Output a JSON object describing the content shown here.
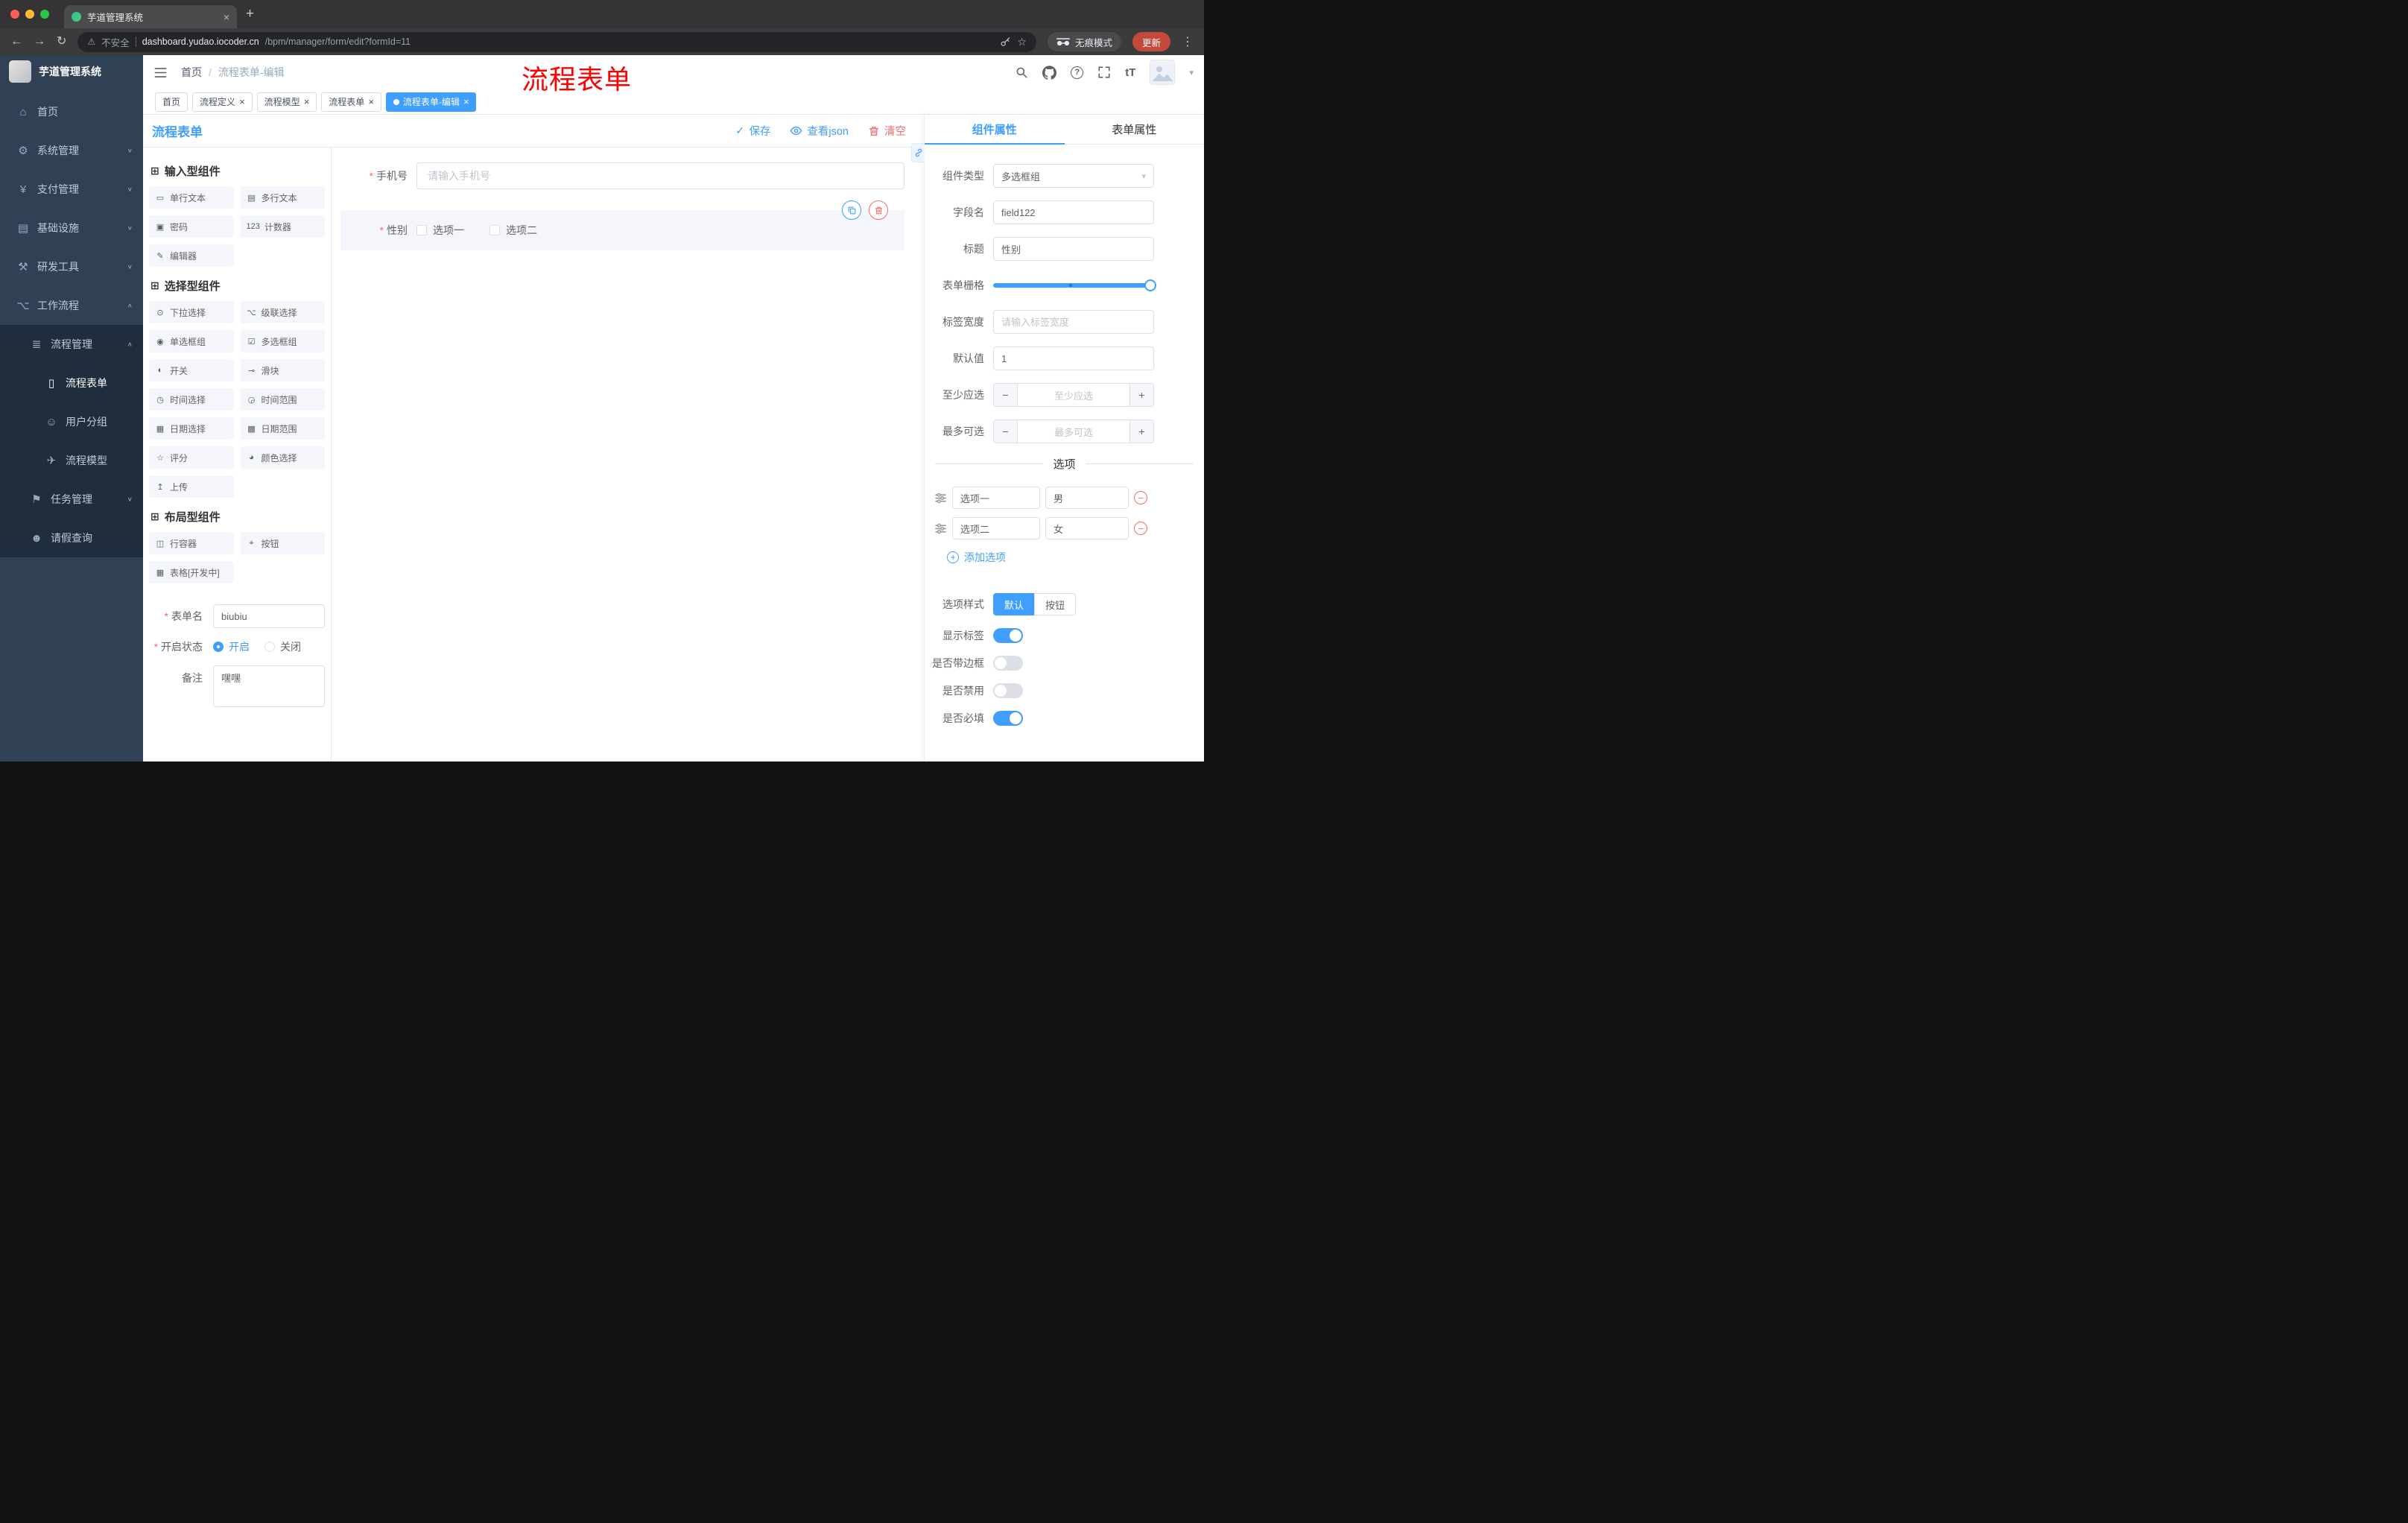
{
  "browser": {
    "tab_title": "芋道管理系统",
    "security_label": "不安全",
    "url_host": "dashboard.yudao.iocoder.cn",
    "url_path": "/bpm/manager/form/edit?formId=11",
    "incognito_label": "无痕模式",
    "update_label": "更新"
  },
  "sidebar": {
    "logo_title": "芋道管理系统",
    "items": [
      {
        "icon": "home",
        "label": "首页",
        "level": 0
      },
      {
        "icon": "gear",
        "label": "系统管理",
        "level": 0,
        "chevron": "down"
      },
      {
        "icon": "yen",
        "label": "支付管理",
        "level": 0,
        "chevron": "down"
      },
      {
        "icon": "monitor",
        "label": "基础设施",
        "level": 0,
        "chevron": "down"
      },
      {
        "icon": "tools",
        "label": "研发工具",
        "level": 0,
        "chevron": "down"
      },
      {
        "icon": "workflow",
        "label": "工作流程",
        "level": 0,
        "chevron": "up"
      },
      {
        "icon": "list",
        "label": "流程管理",
        "level": 1,
        "chevron": "up"
      },
      {
        "icon": "form",
        "label": "流程表单",
        "level": 2,
        "active": true
      },
      {
        "icon": "users",
        "label": "用户分组",
        "level": 2
      },
      {
        "icon": "model",
        "label": "流程模型",
        "level": 2
      },
      {
        "icon": "tasks",
        "label": "任务管理",
        "level": 1,
        "chevron": "down"
      },
      {
        "icon": "person",
        "label": "请假查询",
        "level": 1
      }
    ]
  },
  "navbar": {
    "breadcrumb": [
      "首页",
      "流程表单-编辑"
    ],
    "separator": "/"
  },
  "annotation": "流程表单",
  "tagbar": {
    "tags": [
      {
        "label": "首页",
        "closable": false,
        "active": false
      },
      {
        "label": "流程定义",
        "closable": true,
        "active": false
      },
      {
        "label": "流程模型",
        "closable": true,
        "active": false
      },
      {
        "label": "流程表单",
        "closable": true,
        "active": false
      },
      {
        "label": "流程表单-编辑",
        "closable": true,
        "active": true
      }
    ]
  },
  "designer": {
    "title": "流程表单",
    "toolbar": {
      "save": "保存",
      "view_json": "查看json",
      "clear": "清空"
    },
    "palette": {
      "groups": [
        {
          "title": "输入型组件",
          "items": [
            {
              "icon": "single-line",
              "label": "单行文本"
            },
            {
              "icon": "multi-line",
              "label": "多行文本"
            },
            {
              "icon": "password",
              "label": "密码"
            },
            {
              "icon": "counter",
              "label": "计数器"
            },
            {
              "icon": "editor",
              "label": "编辑器"
            }
          ]
        },
        {
          "title": "选择型组件",
          "items": [
            {
              "icon": "select",
              "label": "下拉选择"
            },
            {
              "icon": "cascader",
              "label": "级联选择"
            },
            {
              "icon": "radio-group",
              "label": "单选框组"
            },
            {
              "icon": "checkbox-group",
              "label": "多选框组"
            },
            {
              "icon": "switch",
              "label": "开关"
            },
            {
              "icon": "slider",
              "label": "滑块"
            },
            {
              "icon": "time",
              "label": "时间选择"
            },
            {
              "icon": "time-range",
              "label": "时间范围"
            },
            {
              "icon": "date",
              "label": "日期选择"
            },
            {
              "icon": "date-range",
              "label": "日期范围"
            },
            {
              "icon": "rate",
              "label": "评分"
            },
            {
              "icon": "color",
              "label": "颜色选择"
            },
            {
              "icon": "upload",
              "label": "上传"
            }
          ]
        },
        {
          "title": "布局型组件",
          "items": [
            {
              "icon": "row",
              "label": "行容器"
            },
            {
              "icon": "button",
              "label": "按钮"
            },
            {
              "icon": "table",
              "label": "表格[开发中]"
            }
          ]
        }
      ]
    },
    "form_meta": {
      "name_label": "表单名",
      "name_value": "biubiu",
      "status_label": "开启状态",
      "status_on": "开启",
      "status_off": "关闭",
      "remark_label": "备注",
      "remark_value": "嘿嘿"
    },
    "canvas": {
      "phone": {
        "label": "手机号",
        "placeholder": "请输入手机号"
      },
      "gender": {
        "label": "性别",
        "options": [
          "选项一",
          "选项二"
        ]
      }
    }
  },
  "props": {
    "tabs": [
      "组件属性",
      "表单属性"
    ],
    "rows": {
      "type": {
        "label": "组件类型",
        "value": "多选框组"
      },
      "field": {
        "label": "字段名",
        "value": "field122"
      },
      "title": {
        "label": "标题",
        "value": "性别"
      },
      "grid": {
        "label": "表单栅格"
      },
      "label_width": {
        "label": "标签宽度",
        "placeholder": "请输入标签宽度"
      },
      "default": {
        "label": "默认值",
        "value": "1"
      },
      "min": {
        "label": "至少应选",
        "placeholder": "至少应选"
      },
      "max": {
        "label": "最多可选",
        "placeholder": "最多可选"
      }
    },
    "options": {
      "divider": "选项",
      "items": [
        {
          "label": "选项一",
          "value": "男"
        },
        {
          "label": "选项二",
          "value": "女"
        }
      ],
      "add": "添加选项"
    },
    "style": {
      "label": "选项样式",
      "default_btn": "默认",
      "button_btn": "按钮"
    },
    "toggles": [
      {
        "label": "显示标签",
        "on": true
      },
      {
        "label": "是否带边框",
        "on": false
      },
      {
        "label": "是否禁用",
        "on": false
      },
      {
        "label": "是否必填",
        "on": true
      }
    ],
    "accent_color": "#409eff",
    "danger_color": "#f56c6c"
  }
}
